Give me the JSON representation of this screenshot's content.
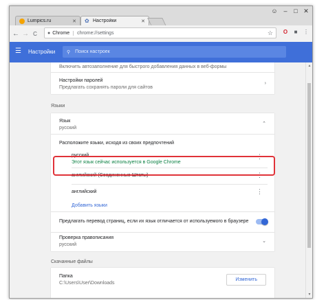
{
  "tabs": [
    {
      "title": "Lumpics.ru",
      "favicon_color": "#f4a300"
    },
    {
      "title": "Настройки",
      "favicon_icon": "gear-icon"
    }
  ],
  "window_controls": {
    "user": "user-icon",
    "minimize": "–",
    "maximize": "□",
    "close": "✕"
  },
  "toolbar": {
    "back": "←",
    "forward": "→",
    "reload": "C",
    "secure_chip": "Chrome",
    "url": "chrome://settings",
    "icons": [
      "star-icon",
      "opera-icon",
      "extension-icon",
      "menu-icon"
    ]
  },
  "header": {
    "title": "Настройки",
    "search_placeholder": "Поиск настроек",
    "bg_color": "#3f6fd9"
  },
  "autofill": {
    "partial_text": "Включить автозаполнение для быстрого добавления данных в веб-формы",
    "passwords_title": "Настройки паролей",
    "passwords_desc": "Предлагать сохранять пароли для сайтов"
  },
  "languages_section": {
    "heading": "Языки",
    "language_title": "Язык",
    "language_value": "русский",
    "order_text": "Расположите языки, исходя из своих предпочтений",
    "items": [
      {
        "name": "русский",
        "note": "Этот язык сейчас используется в Google Chrome"
      },
      {
        "name": "английский (Соединенные Штаты)",
        "note": ""
      },
      {
        "name": "английский",
        "note": ""
      }
    ],
    "add_link": "Добавить языки",
    "translate_offer": "Предлагать перевод страниц, если их язык отличается от используемого в браузере",
    "translate_enabled": true,
    "spellcheck_title": "Проверка правописания",
    "spellcheck_value": "русский"
  },
  "downloads_section": {
    "heading": "Скачанные файлы",
    "folder_title": "Папка",
    "folder_path": "C:\\Users\\User\\Downloads",
    "change_button": "Изменить"
  },
  "colors": {
    "accent": "#3367d6",
    "highlight_border": "#e03138",
    "note_green": "#0b8043"
  }
}
